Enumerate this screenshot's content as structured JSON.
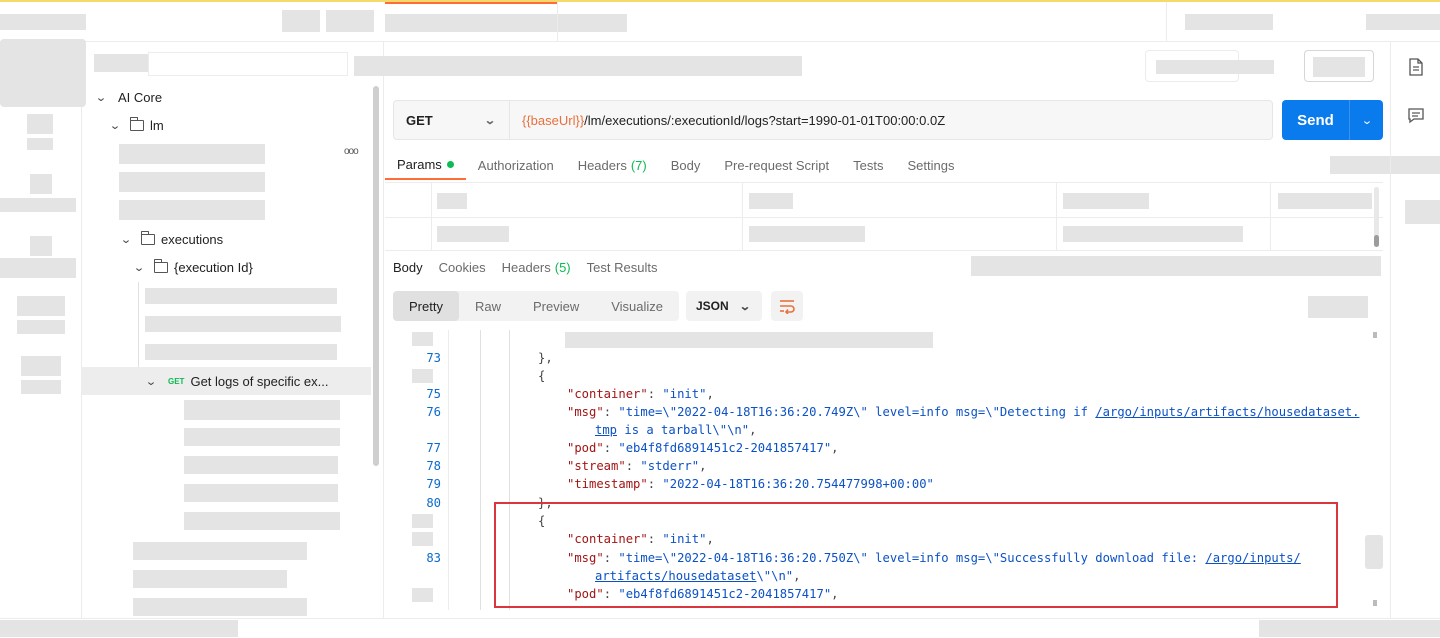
{
  "tree": {
    "root_label": "AI Core",
    "lm_label": "lm",
    "executions_label": "executions",
    "execution_id_label": "{execution Id}",
    "selected_method": "GET",
    "selected_label": "Get logs of specific ex...",
    "more": "ooo"
  },
  "request": {
    "method": "GET",
    "url_var": "{{baseUrl}}",
    "url_rest": "/lm/executions/:executionId/logs?start=1990-01-01T00:00:0.0Z",
    "send_label": "Send",
    "tabs": [
      {
        "label": "Params"
      },
      {
        "label": "Authorization"
      },
      {
        "label": "Headers",
        "count": "(7)"
      },
      {
        "label": "Body"
      },
      {
        "label": "Pre-request Script"
      },
      {
        "label": "Tests"
      },
      {
        "label": "Settings"
      }
    ]
  },
  "response": {
    "tabs": [
      {
        "label": "Body"
      },
      {
        "label": "Cookies"
      },
      {
        "label": "Headers",
        "count": "(5)"
      },
      {
        "label": "Test Results"
      }
    ],
    "views": [
      "Pretty",
      "Raw",
      "Preview",
      "Visualize"
    ],
    "format": "JSON"
  },
  "code_lines": {
    "ln73": "73",
    "ln75": "75",
    "ln76": "76",
    "ln77": "77",
    "ln78": "78",
    "ln79": "79",
    "ln80": "80",
    "ln83": "83",
    "l73": "},",
    "l74": "{",
    "container_key": "\"container\"",
    "container_val": "\"init\"",
    "msg_key": "\"msg\"",
    "msg1_a": "\"time=\\\"2022-04-18T16:36:20.749Z\\\" level=info msg=\\\"Detecting if ",
    "msg1_link": "/argo/inputs/artifacts/housedataset.",
    "msg1_link2": "tmp",
    "msg1_b": " is a tarball\\\"\\n\"",
    "pod_key": "\"pod\"",
    "pod_val": "\"eb4f8fd6891451c2-2041857417\"",
    "stream_key": "\"stream\"",
    "stream_val": "\"stderr\"",
    "ts_key": "\"timestamp\"",
    "ts_val": "\"2022-04-18T16:36:20.754477998+00:00\"",
    "l80": "},",
    "l81": "{",
    "msg2_a": "\"time=\\\"2022-04-18T16:36:20.750Z\\\" level=info msg=\\\"Successfully download file: ",
    "msg2_link": "/argo/inputs/",
    "msg2_link2": "artifacts/housedataset",
    "msg2_b": "\\\"\\n\""
  }
}
